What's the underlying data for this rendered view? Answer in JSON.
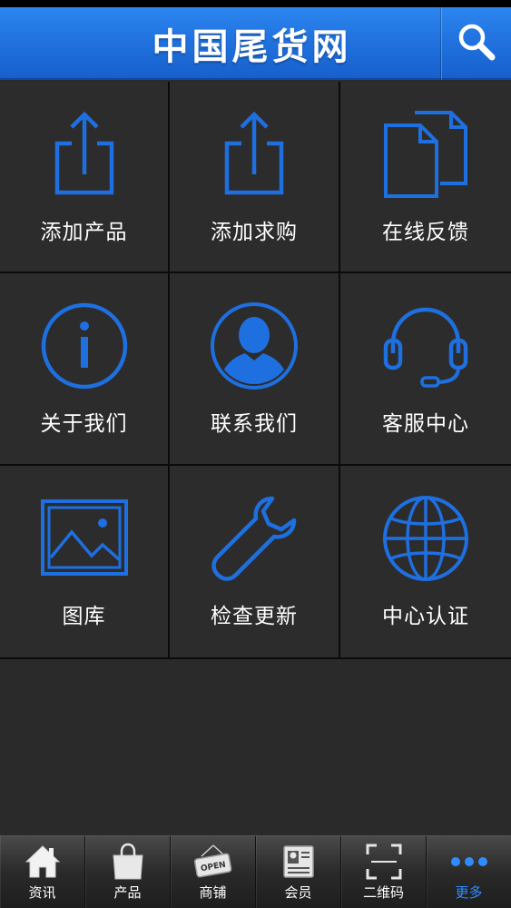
{
  "header": {
    "title": "中国尾货网",
    "search_icon": "search-icon"
  },
  "grid": {
    "items": [
      {
        "label": "添加产品",
        "icon": "share-upload-icon"
      },
      {
        "label": "添加求购",
        "icon": "share-upload-icon"
      },
      {
        "label": "在线反馈",
        "icon": "documents-icon"
      },
      {
        "label": "关于我们",
        "icon": "info-icon"
      },
      {
        "label": "联系我们",
        "icon": "person-icon"
      },
      {
        "label": "客服中心",
        "icon": "headset-icon"
      },
      {
        "label": "图库",
        "icon": "picture-icon"
      },
      {
        "label": "检查更新",
        "icon": "wrench-icon"
      },
      {
        "label": "中心认证",
        "icon": "globe-icon"
      }
    ]
  },
  "tabbar": {
    "tabs": [
      {
        "label": "资讯",
        "icon": "home-icon",
        "active": false
      },
      {
        "label": "产品",
        "icon": "shopping-bag-icon",
        "active": false
      },
      {
        "label": "商铺",
        "icon": "open-sign-icon",
        "active": false
      },
      {
        "label": "会员",
        "icon": "member-card-icon",
        "active": false
      },
      {
        "label": "二维码",
        "icon": "qr-scan-icon",
        "active": false
      },
      {
        "label": "更多",
        "icon": "more-dots-icon",
        "active": true
      }
    ]
  },
  "colors": {
    "accent": "#1e6fe0",
    "header_top": "#2c86ef",
    "background": "#2a2a2a",
    "active_tab": "#2f8cff"
  }
}
